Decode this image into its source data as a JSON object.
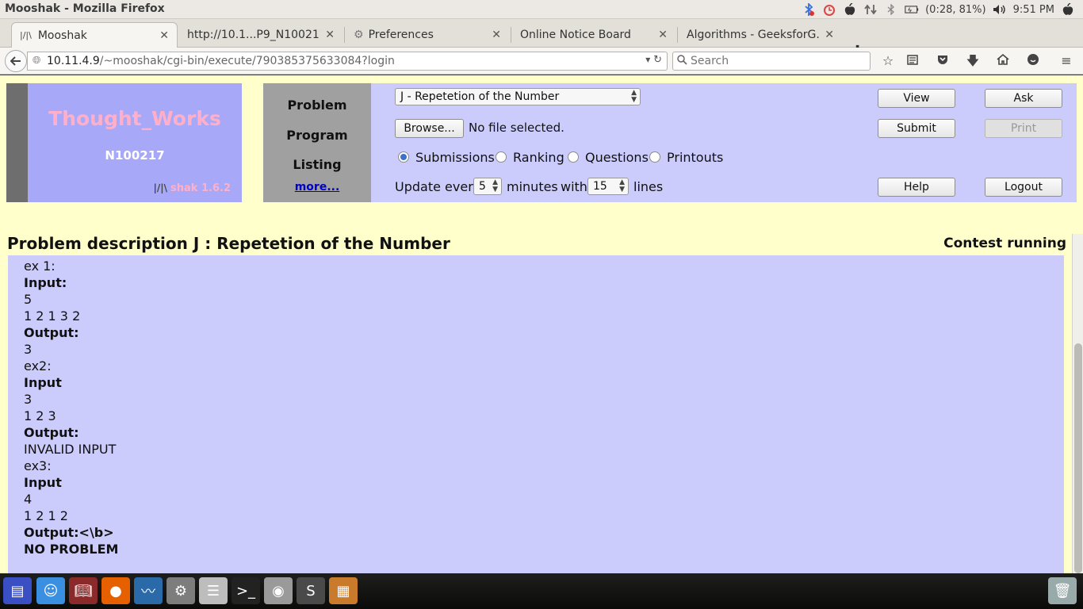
{
  "window": {
    "title": "Mooshak - Mozilla Firefox",
    "tray": {
      "battery": "(0:28, 81%)",
      "time": "9:51 PM"
    }
  },
  "tabs": [
    {
      "label": "Mooshak",
      "active": true
    },
    {
      "label": "http://10.1...P9_N100217",
      "active": false
    },
    {
      "label": "Preferences",
      "active": false
    },
    {
      "label": "Online Notice Board",
      "active": false
    },
    {
      "label": "Algorithms - GeeksforG...",
      "active": false
    }
  ],
  "nav": {
    "url_host": "10.11.4.9",
    "url_path": "/~mooshak/cgi-bin/execute/790385375633084?login",
    "search_placeholder": "Search"
  },
  "mooshak": {
    "team": "Thought_Works",
    "user": "N100217",
    "version": "shak 1.6.2",
    "labels": {
      "problem": "Problem",
      "program": "Program",
      "listing": "Listing",
      "more": "more..."
    },
    "problem_selected": "J - Repetetion of the Number",
    "browse_label": "Browse...",
    "file_status": "No file selected.",
    "listing_options": [
      "Submissions",
      "Ranking",
      "Questions",
      "Printouts"
    ],
    "listing_selected": "Submissions",
    "update_prefix": "Update every",
    "update_minutes": "5",
    "update_mid": "minutes",
    "update_with": "with",
    "update_lines": "15",
    "update_suffix": "lines",
    "buttons": {
      "view": "View",
      "ask": "Ask",
      "submit": "Submit",
      "print": "Print",
      "help": "Help",
      "logout": "Logout"
    }
  },
  "problem": {
    "title": "Problem description J : Repetetion of the Number",
    "status": "Contest running",
    "lines": [
      {
        "text": "ex 1:",
        "bold": false
      },
      {
        "text": "Input:",
        "bold": true
      },
      {
        "text": "5",
        "bold": false
      },
      {
        "text": "1 2 1 3 2",
        "bold": false
      },
      {
        "text": "Output:",
        "bold": true
      },
      {
        "text": "3",
        "bold": false
      },
      {
        "text": "ex2:",
        "bold": false
      },
      {
        "text": "Input",
        "bold": true
      },
      {
        "text": "3",
        "bold": false
      },
      {
        "text": "1 2 3",
        "bold": false
      },
      {
        "text": "Output:",
        "bold": true
      },
      {
        "text": "INVALID INPUT",
        "bold": false
      },
      {
        "text": "ex3:",
        "bold": false
      },
      {
        "text": "Input",
        "bold": true
      },
      {
        "text": "4",
        "bold": false
      },
      {
        "text": "1 2 1 2",
        "bold": false
      },
      {
        "text": "Output:<\\b>",
        "bold": true
      },
      {
        "text": "NO PROBLEM",
        "bold": true
      }
    ]
  },
  "dock": [
    "show-desktop-icon",
    "finder-icon",
    "dictionary-icon",
    "firefox-icon",
    "system-monitor-icon",
    "system-preferences-icon",
    "mixer-icon",
    "terminal-icon",
    "disk-utility-icon",
    "sublime-text-icon",
    "calculator-icon",
    "trash-icon"
  ]
}
